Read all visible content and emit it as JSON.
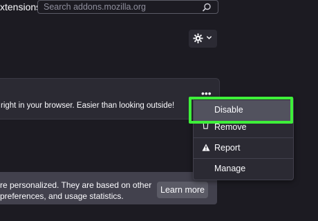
{
  "header": {
    "title_fragment": "xtensions",
    "search_placeholder": "Search addons.mozilla.org"
  },
  "tools": {
    "gear_icon": "gear-icon",
    "chevron_icon": "chevron-down-icon"
  },
  "extension_card": {
    "description_fragment": "right in your browser. Easier than looking outside!",
    "more_options_label": "•••"
  },
  "context_menu": {
    "items": [
      {
        "label": "Disable",
        "icon": ""
      },
      {
        "label": "Remove",
        "icon": "trash-icon"
      },
      {
        "label": "Report",
        "icon": "warning-icon"
      },
      {
        "label": "Manage",
        "icon": ""
      }
    ]
  },
  "recommendations": {
    "line1": "re personalized. They are based on other",
    "line2": "preferences, and usage statistics.",
    "learn_more": "Learn more"
  },
  "colors": {
    "highlight": "#3ef03a",
    "background": "#1c1b22",
    "card": "#2b2a33"
  }
}
